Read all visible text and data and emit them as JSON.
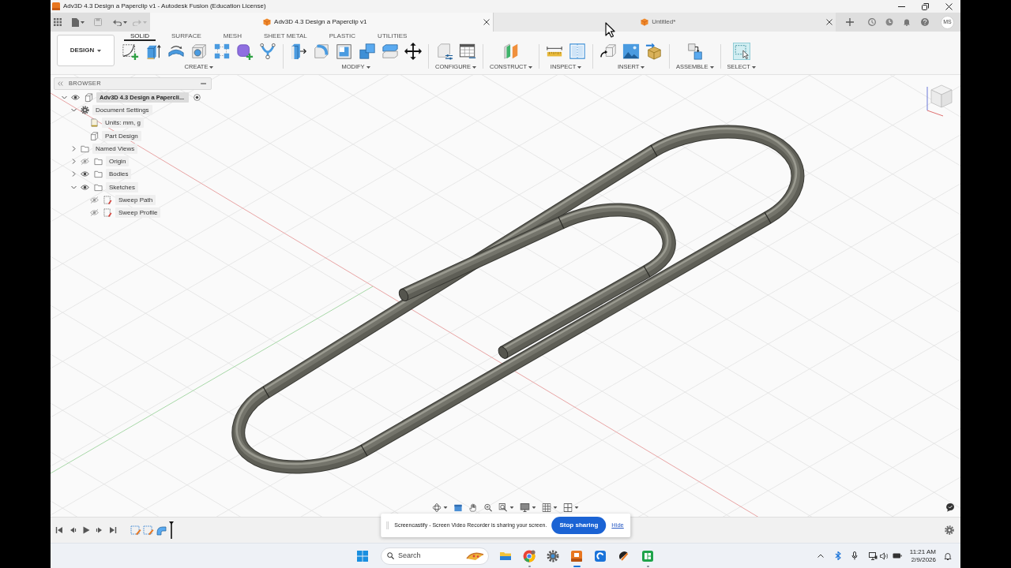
{
  "window": {
    "title": "Adv3D 4.3 Design a Paperclip v1 - Autodesk Fusion (Education License)"
  },
  "document_tabs": [
    {
      "title": "Adv3D 4.3 Design a Paperclip v1",
      "selected": true
    },
    {
      "title": "Untitled*",
      "selected": false
    }
  ],
  "user": {
    "initials": "MS"
  },
  "workspace_button": "DESIGN",
  "toolbar_tabs": [
    {
      "label": "SOLID",
      "selected": true
    },
    {
      "label": "SURFACE",
      "selected": false
    },
    {
      "label": "MESH",
      "selected": false
    },
    {
      "label": "SHEET METAL",
      "selected": false
    },
    {
      "label": "PLASTIC",
      "selected": false
    },
    {
      "label": "UTILITIES",
      "selected": false
    }
  ],
  "tool_groups": [
    {
      "kind": "create",
      "label": "CREATE"
    },
    {
      "kind": "modify",
      "label": "MODIFY"
    },
    {
      "kind": "configure",
      "label": "CONFIGURE"
    },
    {
      "kind": "construct",
      "label": "CONSTRUCT"
    },
    {
      "kind": "inspect",
      "label": "INSPECT"
    },
    {
      "kind": "insert",
      "label": "INSERT"
    },
    {
      "kind": "assemble",
      "label": "ASSEMBLE"
    },
    {
      "kind": "select",
      "label": "SELECT"
    }
  ],
  "browser": {
    "title": "BROWSER",
    "items": [
      {
        "kind": "component",
        "label": "Adv3D 4.3 Design a Papercli...",
        "selected": true,
        "expanded": true,
        "visible": true,
        "children": [
          {
            "kind": "settings",
            "label": "Document Settings",
            "selected": false,
            "expanded": true,
            "children": [
              {
                "kind": "units",
                "label": "Units: mm, g",
                "selected": false
              },
              {
                "kind": "design",
                "label": "Part Design",
                "selected": false
              }
            ]
          },
          {
            "kind": "folder",
            "label": "Named Views",
            "selected": false,
            "expanded": false
          },
          {
            "kind": "folder",
            "label": "Origin",
            "selected": false,
            "expanded": false,
            "visible": false
          },
          {
            "kind": "folder",
            "label": "Bodies",
            "selected": false,
            "expanded": false,
            "visible": true
          },
          {
            "kind": "folder",
            "label": "Sketches",
            "selected": false,
            "expanded": true,
            "visible": true,
            "children": [
              {
                "kind": "sketch",
                "label": "Sweep Path",
                "selected": false,
                "visible": false
              },
              {
                "kind": "sketch",
                "label": "Sweep Profile",
                "selected": false,
                "visible": false
              }
            ]
          }
        ]
      }
    ]
  },
  "notification": {
    "message": "Screencastify - Screen Video Recorder is sharing your screen.",
    "button": "Stop sharing",
    "link": "Hide"
  },
  "taskbar": {
    "search_placeholder": "Search",
    "apps": [
      {
        "kind": "folder",
        "running": false,
        "active": false
      },
      {
        "kind": "browser",
        "running": true,
        "active": false
      },
      {
        "kind": "gear",
        "running": false,
        "active": false
      },
      {
        "kind": "cad",
        "running": true,
        "active": true
      },
      {
        "kind": "c-tile",
        "running": false,
        "active": false
      },
      {
        "kind": "disc",
        "running": false,
        "active": false
      },
      {
        "kind": "grid-tile",
        "running": true,
        "active": false
      }
    ],
    "time": "11:21 AM",
    "date": "2/9/2026"
  }
}
